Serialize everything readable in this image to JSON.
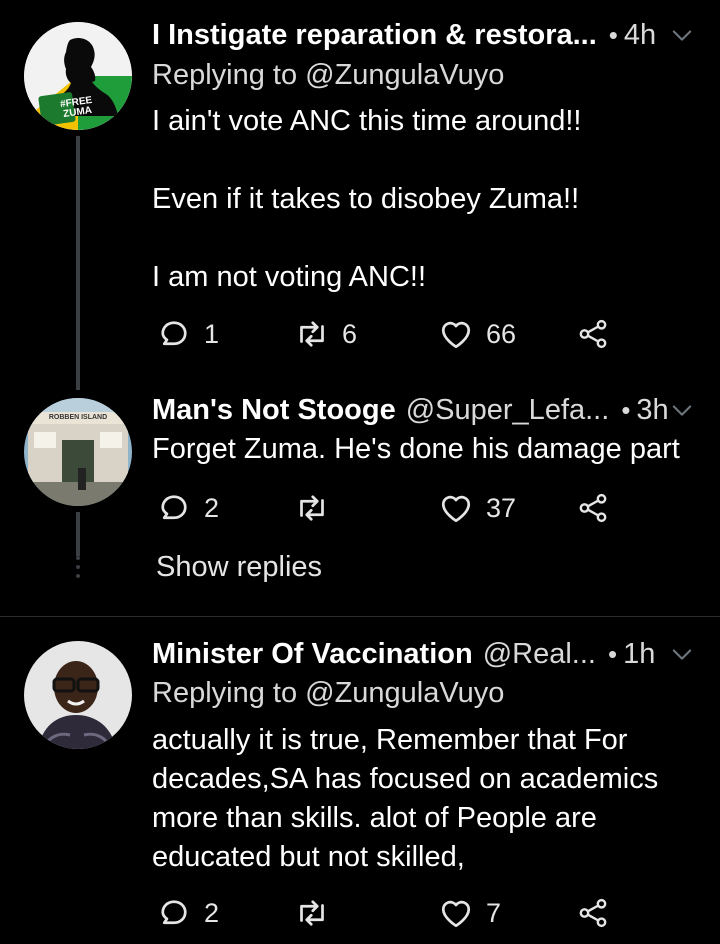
{
  "tweets": [
    {
      "name": "I Instigate reparation & restora...",
      "handle": "",
      "time": "4h",
      "reply_to": "Replying to @ZungulaVuyo",
      "avatar_badge": "#FREE ZUMA",
      "body": [
        "I ain't vote ANC this time around!!",
        "Even if it takes to disobey Zuma!!",
        "I am not voting ANC!!"
      ],
      "replies": "1",
      "retweets": "6",
      "likes": "66"
    },
    {
      "name": "Man's Not Stooge",
      "handle": "@Super_Lefa...",
      "time": "3h",
      "avatar_sign": "ROBBEN ISLAND",
      "body": [
        "Forget Zuma. He's done his damage part"
      ],
      "replies": "2",
      "retweets": "",
      "likes": "37"
    },
    {
      "name": "Minister Of Vaccination",
      "handle": "@Real...",
      "time": "1h",
      "reply_to": "Replying to @ZungulaVuyo",
      "body": [
        "actually it is true, Remember that For decades,SA has focused on academics more than skills. alot of People are educated but not skilled,"
      ],
      "replies": "2",
      "retweets": "",
      "likes": "7"
    }
  ],
  "show_replies": "Show replies",
  "icons": [
    "reply-icon",
    "retweet-icon",
    "like-icon",
    "share-icon",
    "chevron-down-icon"
  ],
  "colors": {
    "background": "#000000",
    "text": "#ffffff",
    "secondary": "#d9d9d9",
    "thread_line": "#3a3f44"
  }
}
